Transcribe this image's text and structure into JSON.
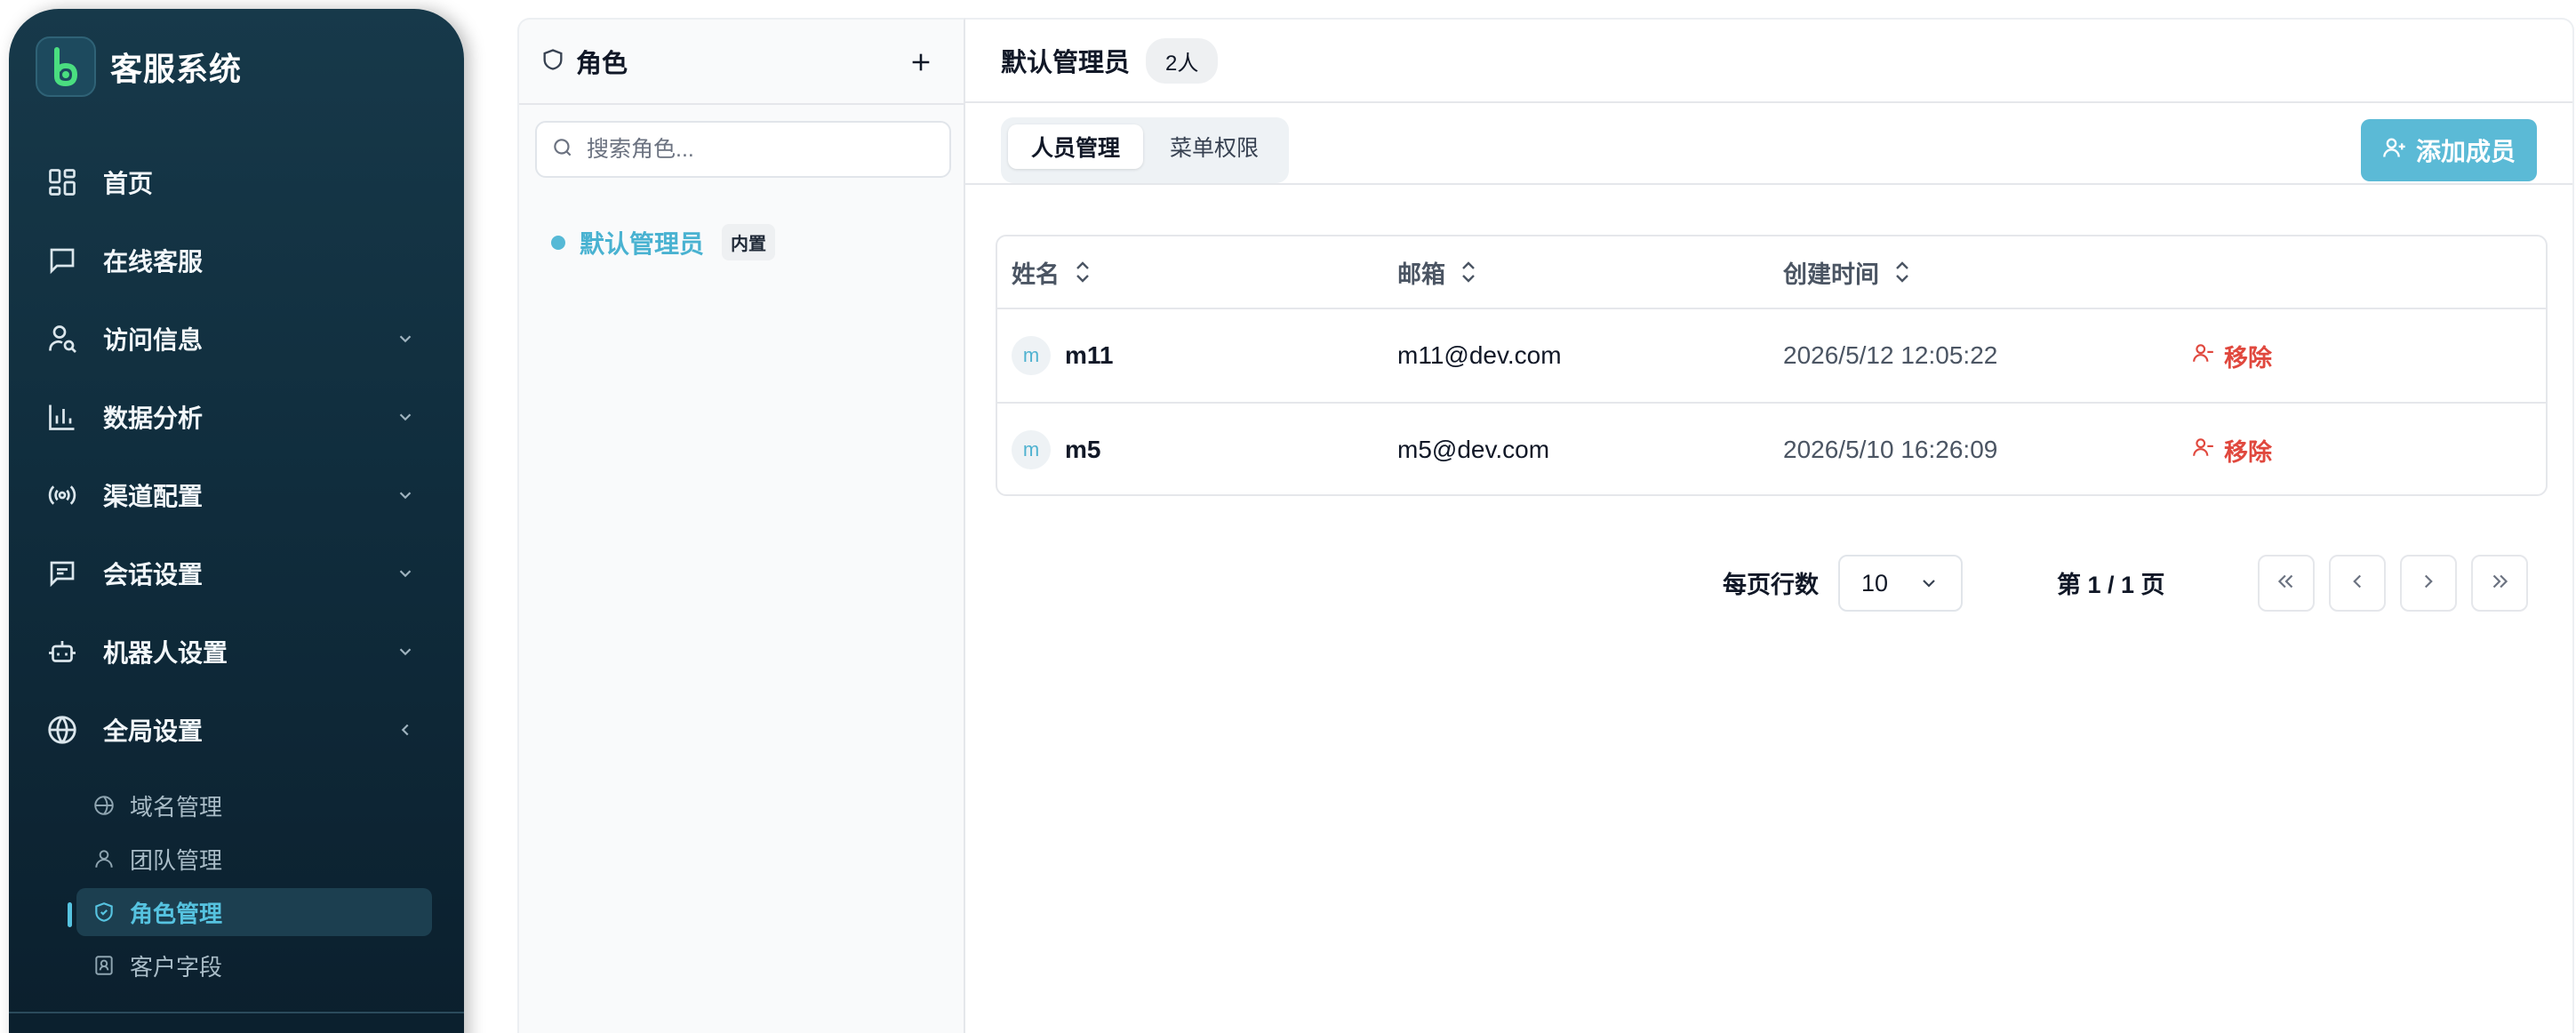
{
  "app": {
    "title": "客服系统"
  },
  "colors": {
    "accent": "#56c3e0",
    "sidebar_bg": "#102d3d",
    "danger": "#e0483e",
    "primary_button": "#5bbad6"
  },
  "sidebar": {
    "items": [
      {
        "label": "首页",
        "icon": "dashboard-grid-icon"
      },
      {
        "label": "在线客服",
        "icon": "chat-bubble-icon"
      },
      {
        "label": "访问信息",
        "icon": "user-search-icon",
        "expandable": true
      },
      {
        "label": "数据分析",
        "icon": "bar-chart-icon",
        "expandable": true
      },
      {
        "label": "渠道配置",
        "icon": "broadcast-icon",
        "expandable": true
      },
      {
        "label": "会话设置",
        "icon": "message-square-icon",
        "expandable": true
      },
      {
        "label": "机器人设置",
        "icon": "robot-icon",
        "expandable": true
      },
      {
        "label": "全局设置",
        "icon": "globe-icon",
        "expanded": true
      }
    ],
    "sub_items": [
      {
        "label": "域名管理",
        "icon": "globe-small-icon"
      },
      {
        "label": "团队管理",
        "icon": "user-icon"
      },
      {
        "label": "角色管理",
        "icon": "shield-check-icon",
        "active": true
      },
      {
        "label": "客户字段",
        "icon": "contact-card-icon"
      }
    ]
  },
  "roles_panel": {
    "title": "角色",
    "search_placeholder": "搜索角色...",
    "roles": [
      {
        "name": "默认管理员",
        "tag": "内置"
      }
    ]
  },
  "main": {
    "title": "默认管理员",
    "member_count": "2人",
    "tabs": [
      {
        "label": "人员管理",
        "active": true
      },
      {
        "label": "菜单权限"
      }
    ],
    "add_button": "添加成员",
    "table": {
      "columns": [
        "姓名",
        "邮箱",
        "创建时间"
      ],
      "rows": [
        {
          "avatar": "m",
          "name": "m11",
          "email": "m11@dev.com",
          "created": "2026/5/12 12:05:22",
          "action": "移除"
        },
        {
          "avatar": "m",
          "name": "m5",
          "email": "m5@dev.com",
          "created": "2026/5/10 16:26:09",
          "action": "移除"
        }
      ]
    },
    "pagination": {
      "rows_per_page_label": "每页行数",
      "rows_per_page": "10",
      "page_info": "第 1 / 1 页"
    }
  }
}
